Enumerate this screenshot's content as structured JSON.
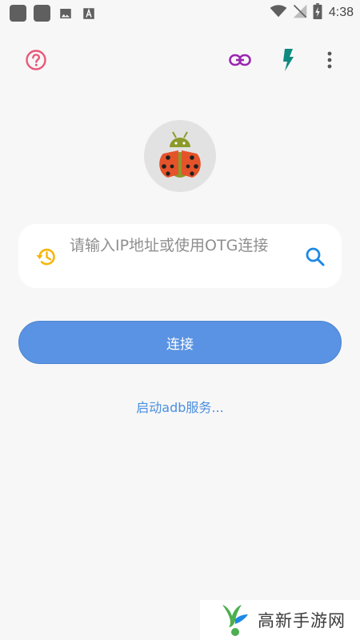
{
  "status_bar": {
    "time": "4:38",
    "icons": [
      "notification-square-icon",
      "notification-square-icon",
      "image-icon",
      "text-notification-icon",
      "wifi-icon",
      "no-signal-icon",
      "battery-charging-icon"
    ]
  },
  "toolbar": {
    "icons": [
      "help-icon",
      "link-icon",
      "flash-icon",
      "more-vert-icon"
    ],
    "colors": {
      "help": "#e8597a",
      "link": "#9c27b0",
      "flash": "#0f8a80",
      "more": "#555555"
    }
  },
  "app": {
    "logo": "ladybug-android-icon"
  },
  "address_input": {
    "placeholder": "请输入IP地址或使用OTG连接",
    "history_icon": "history-icon",
    "search_icon": "search-icon",
    "colors": {
      "history": "#f5b50a",
      "search": "#1e88e5"
    }
  },
  "connect_button": {
    "label": "连接",
    "color": "#5a93e3"
  },
  "adb_link": {
    "label": "启动adb服务..."
  },
  "watermark": {
    "text": "高新手游网"
  }
}
